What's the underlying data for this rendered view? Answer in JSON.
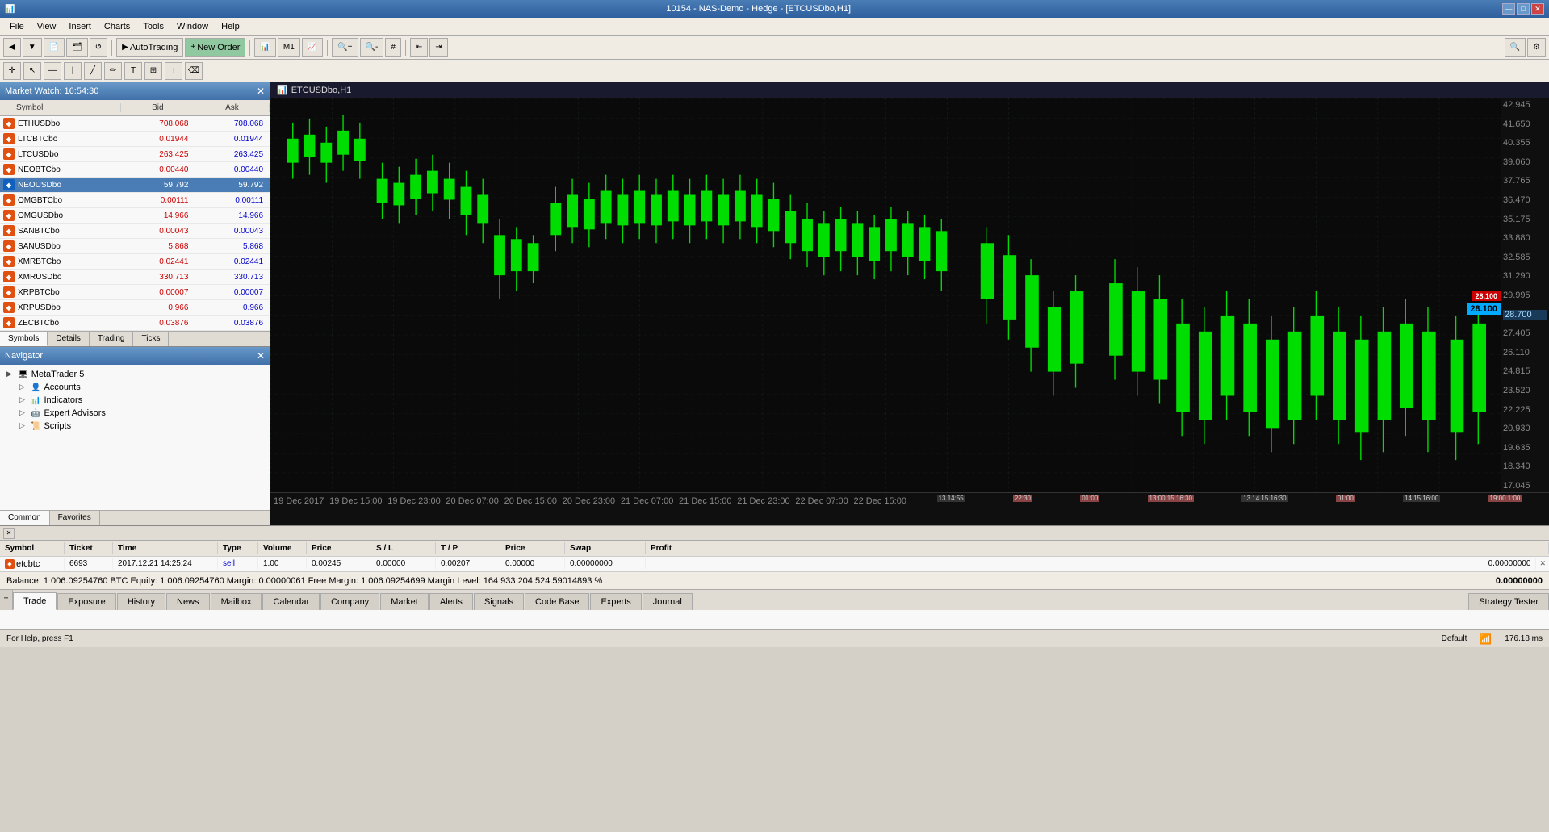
{
  "titlebar": {
    "title": "10154 - NAS-Demo - Hedge - [ETCUSDbo,H1]",
    "controls": [
      "—",
      "□",
      "✕"
    ]
  },
  "menubar": {
    "items": [
      "File",
      "View",
      "Insert",
      "Charts",
      "Tools",
      "Window",
      "Help"
    ]
  },
  "toolbar": {
    "buttons": [
      "AutoTrading",
      "New Order"
    ],
    "icons": [
      "chart-bar",
      "chart-period",
      "chart-line",
      "zoom-in",
      "zoom-out",
      "grid",
      "scroll-left",
      "scroll-right"
    ]
  },
  "market_watch": {
    "title": "Market Watch: 16:54:30",
    "columns": [
      "Symbol",
      "Bid",
      "Ask"
    ],
    "symbols": [
      {
        "name": "ETHUSDbo",
        "bid": "708.068",
        "ask": "708.068",
        "icon": "red",
        "selected": false
      },
      {
        "name": "LTCBTCbo",
        "bid": "0.01944",
        "ask": "0.01944",
        "icon": "red",
        "selected": false
      },
      {
        "name": "LTCUSDbo",
        "bid": "263.425",
        "ask": "263.425",
        "icon": "red",
        "selected": false
      },
      {
        "name": "NEOBTCbo",
        "bid": "0.00440",
        "ask": "0.00440",
        "icon": "red",
        "selected": false
      },
      {
        "name": "NEOUSDbo",
        "bid": "59.792",
        "ask": "59.792",
        "icon": "blue",
        "selected": true
      },
      {
        "name": "OMGBTCbo",
        "bid": "0.00111",
        "ask": "0.00111",
        "icon": "red",
        "selected": false
      },
      {
        "name": "OMGUSDbo",
        "bid": "14.966",
        "ask": "14.966",
        "icon": "red",
        "selected": false
      },
      {
        "name": "SANBTCbo",
        "bid": "0.00043",
        "ask": "0.00043",
        "icon": "red",
        "selected": false
      },
      {
        "name": "SANUSDbo",
        "bid": "5.868",
        "ask": "5.868",
        "icon": "red",
        "selected": false
      },
      {
        "name": "XMRBTCbo",
        "bid": "0.02441",
        "ask": "0.02441",
        "icon": "red",
        "selected": false
      },
      {
        "name": "XMRUSDbo",
        "bid": "330.713",
        "ask": "330.713",
        "icon": "red",
        "selected": false
      },
      {
        "name": "XRPBTCbo",
        "bid": "0.00007",
        "ask": "0.00007",
        "icon": "red",
        "selected": false
      },
      {
        "name": "XRPUSDbo",
        "bid": "0.966",
        "ask": "0.966",
        "icon": "red",
        "selected": false
      },
      {
        "name": "ZECBTCbo",
        "bid": "0.03876",
        "ask": "0.03876",
        "icon": "red",
        "selected": false
      }
    ],
    "tabs": [
      "Symbols",
      "Details",
      "Trading",
      "Ticks"
    ]
  },
  "navigator": {
    "title": "Navigator",
    "items": [
      {
        "label": "MetaTrader 5",
        "level": 0
      },
      {
        "label": "Accounts",
        "level": 1
      },
      {
        "label": "Indicators",
        "level": 1
      },
      {
        "label": "Expert Advisors",
        "level": 1
      },
      {
        "label": "Scripts",
        "level": 1
      }
    ],
    "tabs": [
      "Common",
      "Favorites"
    ]
  },
  "chart": {
    "title": "ETCUSDbo,H1",
    "symbol": "ETCUSDbo",
    "timeframe": "H1",
    "current_price": "28.100",
    "price_labels": [
      "42.945",
      "41.650",
      "40.355",
      "39.060",
      "37.765",
      "36.470",
      "35.175",
      "33.880",
      "32.585",
      "31.290",
      "29.995",
      "28.700",
      "27.405",
      "26.110",
      "24.815",
      "23.520",
      "22.225",
      "20.930",
      "19.635",
      "18.340",
      "17.045"
    ],
    "time_labels": [
      "19 Dec 2017",
      "19 Dec 15:00",
      "19 Dec 23:00",
      "20 Dec 07:00",
      "20 Dec 15:00",
      "20 Dec 23:00",
      "21 Dec 07:00",
      "21 Dec 15:00",
      "21 Dec 23:00",
      "22 Dec 07:00",
      "22 Dec 15:00"
    ]
  },
  "trades": {
    "columns": [
      "Symbol",
      "Ticket",
      "Time",
      "Type",
      "Volume",
      "Price",
      "S / L",
      "T / P",
      "Price",
      "Swap",
      "Profit"
    ],
    "rows": [
      {
        "symbol": "etcbtc",
        "ticket": "6693",
        "time": "2017.12.21 14:25:24",
        "type": "sell",
        "volume": "1.00",
        "price": "0.00245",
        "sl": "0.00000",
        "tp": "0.00207",
        "curr_price": "0.00000",
        "swap": "0.00000000",
        "profit": "0.00000000"
      }
    ],
    "balance_text": "Balance: 1 006.09254760 BTC  Equity: 1 006.09254760  Margin: 0.00000061  Free Margin: 1 006.09254699  Margin Level: 164 933 204 524.59014893 %",
    "total_profit": "0.00000000"
  },
  "bottom_tabs": [
    "Trade",
    "Exposure",
    "History",
    "News",
    "Mailbox",
    "Calendar",
    "Company",
    "Market",
    "Alerts",
    "Signals",
    "Code Base",
    "Experts",
    "Journal"
  ],
  "bottom_tabs_active": "Trade",
  "strategy_tester_label": "Strategy Tester",
  "statusbar": {
    "help_text": "For Help, press F1",
    "default_text": "Default",
    "ping_text": "176.18 ms"
  }
}
